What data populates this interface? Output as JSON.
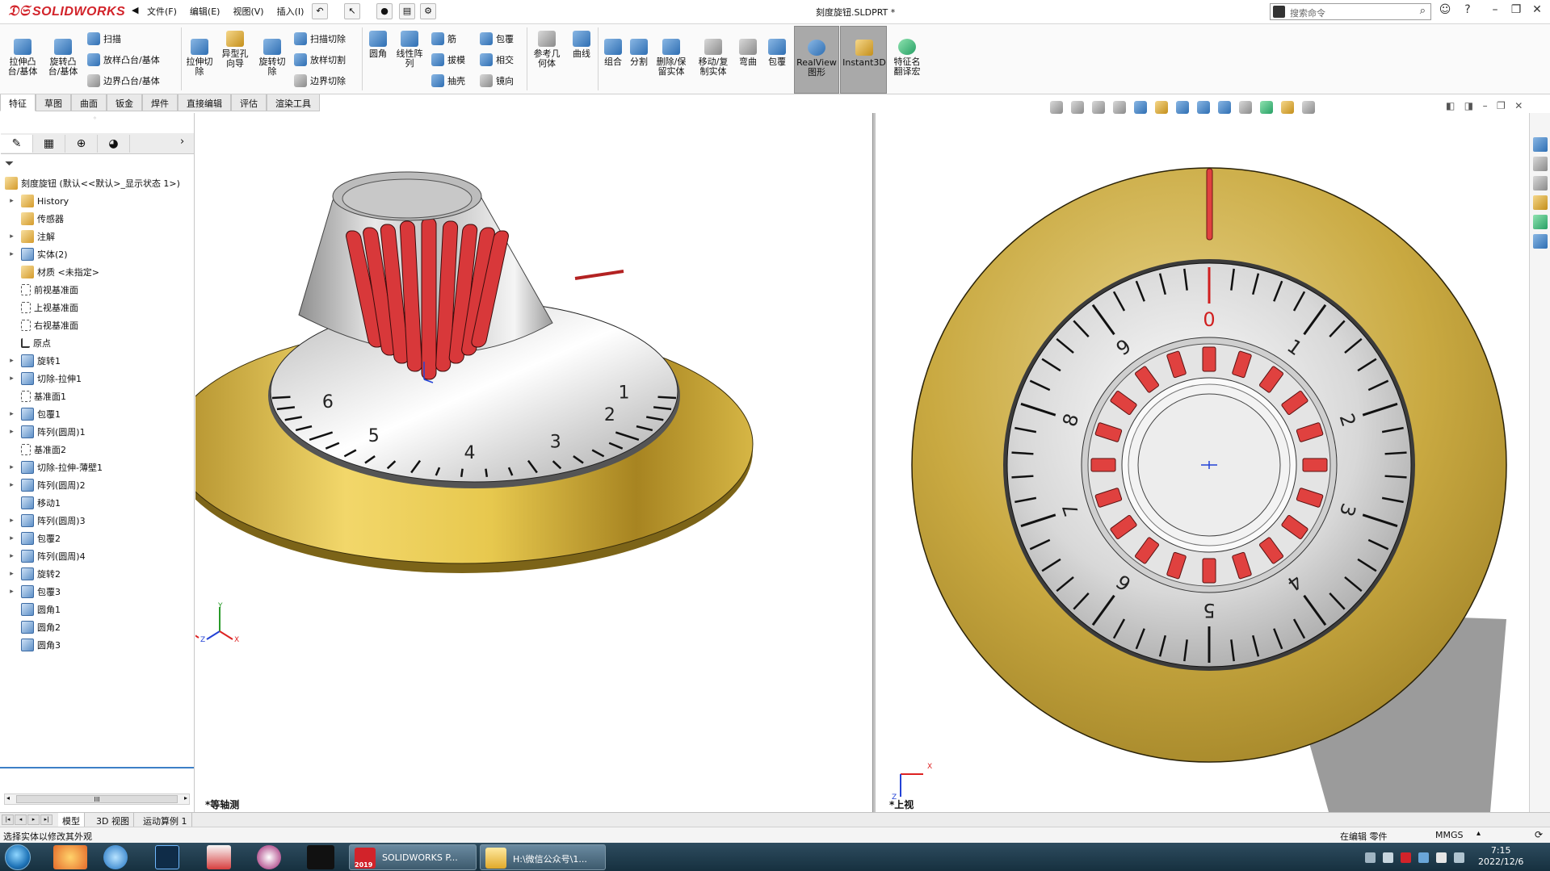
{
  "app": {
    "brand": "SOLIDWORKS",
    "doc_title": "刻度旋钮.SLDPRT *",
    "search_placeholder": "搜索命令"
  },
  "menu": [
    "文件(F)",
    "编辑(E)",
    "视图(V)",
    "插入(I)"
  ],
  "ribbon": {
    "extrude_boss": "拉伸凸\n台/基体",
    "revolve_boss": "旋转凸\n台/基体",
    "sweep": "扫描",
    "loft_boss": "放样凸台/基体",
    "boundary_boss": "边界凸台/基体",
    "extrude_cut": "拉伸切\n除",
    "hole_wizard": "异型孔\n向导",
    "revolve_cut": "旋转切\n除",
    "sweep_cut": "扫描切除",
    "loft_cut": "放样切割",
    "boundary_cut": "边界切除",
    "fillet": "圆角",
    "linear_pattern": "线性阵\n列",
    "rib": "筋",
    "draft": "拔模",
    "shell": "抽壳",
    "wrap": "包覆",
    "intersect": "相交",
    "mirror": "镜向",
    "ref_geometry": "参考几\n何体",
    "curves": "曲线",
    "combine": "组合",
    "split": "分割",
    "delete_keep_body": "删除/保\n留实体",
    "move_copy_body": "移动/复\n制实体",
    "flex": "弯曲",
    "wrap2": "包覆",
    "realview": "RealView\n图形",
    "instant3d": "Instant3D",
    "feature_name_translate": "特征名\n翻译宏"
  },
  "tabs": [
    "特征",
    "草图",
    "曲面",
    "钣金",
    "焊件",
    "直接编辑",
    "评估",
    "渲染工具"
  ],
  "active_tab": "特征",
  "tree": {
    "root": "刻度旋钮 (默认<<默认>_显示状态 1>)",
    "items": [
      {
        "label": "History",
        "expandable": true,
        "icon": "history-icon",
        "kind": "doc"
      },
      {
        "label": "传感器",
        "expandable": false,
        "icon": "sensor-icon",
        "kind": "doc"
      },
      {
        "label": "注解",
        "expandable": true,
        "icon": "annotation-icon",
        "kind": "doc"
      },
      {
        "label": "实体(2)",
        "expandable": true,
        "icon": "solid-bodies-icon",
        "kind": "feat"
      },
      {
        "label": "材质 <未指定>",
        "expandable": false,
        "icon": "material-icon",
        "kind": "doc"
      },
      {
        "label": "前视基准面",
        "expandable": false,
        "icon": "plane-icon",
        "kind": "plane"
      },
      {
        "label": "上视基准面",
        "expandable": false,
        "icon": "plane-icon",
        "kind": "plane"
      },
      {
        "label": "右视基准面",
        "expandable": false,
        "icon": "plane-icon",
        "kind": "plane"
      },
      {
        "label": "原点",
        "expandable": false,
        "icon": "origin-icon",
        "kind": "origin"
      },
      {
        "label": "旋转1",
        "expandable": true,
        "icon": "revolve-icon",
        "kind": "feat"
      },
      {
        "label": "切除-拉伸1",
        "expandable": true,
        "icon": "cut-extrude-icon",
        "kind": "feat"
      },
      {
        "label": "基准面1",
        "expandable": false,
        "icon": "plane-icon",
        "kind": "plane"
      },
      {
        "label": "包覆1",
        "expandable": true,
        "icon": "wrap-icon",
        "kind": "feat"
      },
      {
        "label": "阵列(圆周)1",
        "expandable": true,
        "icon": "circular-pattern-icon",
        "kind": "feat"
      },
      {
        "label": "基准面2",
        "expandable": false,
        "icon": "plane-icon",
        "kind": "plane"
      },
      {
        "label": "切除-拉伸-薄壁1",
        "expandable": true,
        "icon": "cut-extrude-thin-icon",
        "kind": "feat"
      },
      {
        "label": "阵列(圆周)2",
        "expandable": true,
        "icon": "circular-pattern-icon",
        "kind": "feat"
      },
      {
        "label": "移动1",
        "expandable": false,
        "icon": "move-icon",
        "kind": "feat"
      },
      {
        "label": "阵列(圆周)3",
        "expandable": true,
        "icon": "circular-pattern-icon",
        "kind": "feat"
      },
      {
        "label": "包覆2",
        "expandable": true,
        "icon": "wrap-icon",
        "kind": "feat"
      },
      {
        "label": "阵列(圆周)4",
        "expandable": true,
        "icon": "circular-pattern-icon",
        "kind": "feat"
      },
      {
        "label": "旋转2",
        "expandable": true,
        "icon": "revolve-icon",
        "kind": "feat"
      },
      {
        "label": "包覆3",
        "expandable": true,
        "icon": "wrap-icon",
        "kind": "feat"
      },
      {
        "label": "圆角1",
        "expandable": false,
        "icon": "fillet-icon",
        "kind": "feat"
      },
      {
        "label": "圆角2",
        "expandable": false,
        "icon": "fillet-icon",
        "kind": "feat"
      },
      {
        "label": "圆角3",
        "expandable": false,
        "icon": "fillet-icon",
        "kind": "feat"
      }
    ]
  },
  "viewports": {
    "left_label": "*等轴测",
    "right_label": "*上视",
    "axis_x": "X",
    "axis_y": "Y",
    "axis_z": "Z",
    "dial_digits": [
      "0",
      "1",
      "2",
      "3",
      "4",
      "5",
      "6",
      "7",
      "8",
      "9"
    ]
  },
  "bottom_tabs": [
    "模型",
    "3D 视图",
    "运动算例 1"
  ],
  "status": {
    "message": "选择实体以修改其外观",
    "edit_mode": "在编辑 零件",
    "units": "MMGS"
  },
  "taskbar": {
    "windows": [
      "SOLIDWORKS P...",
      "H:\\微信公众号\\1..."
    ],
    "sw_badge": "2019",
    "time": "7:15",
    "date": "2022/12/6"
  },
  "colors": {
    "brand_red": "#d2232a",
    "brass": "#c9a93f",
    "dial_red": "#e0413f",
    "tree_accent": "#3d7fc7"
  }
}
